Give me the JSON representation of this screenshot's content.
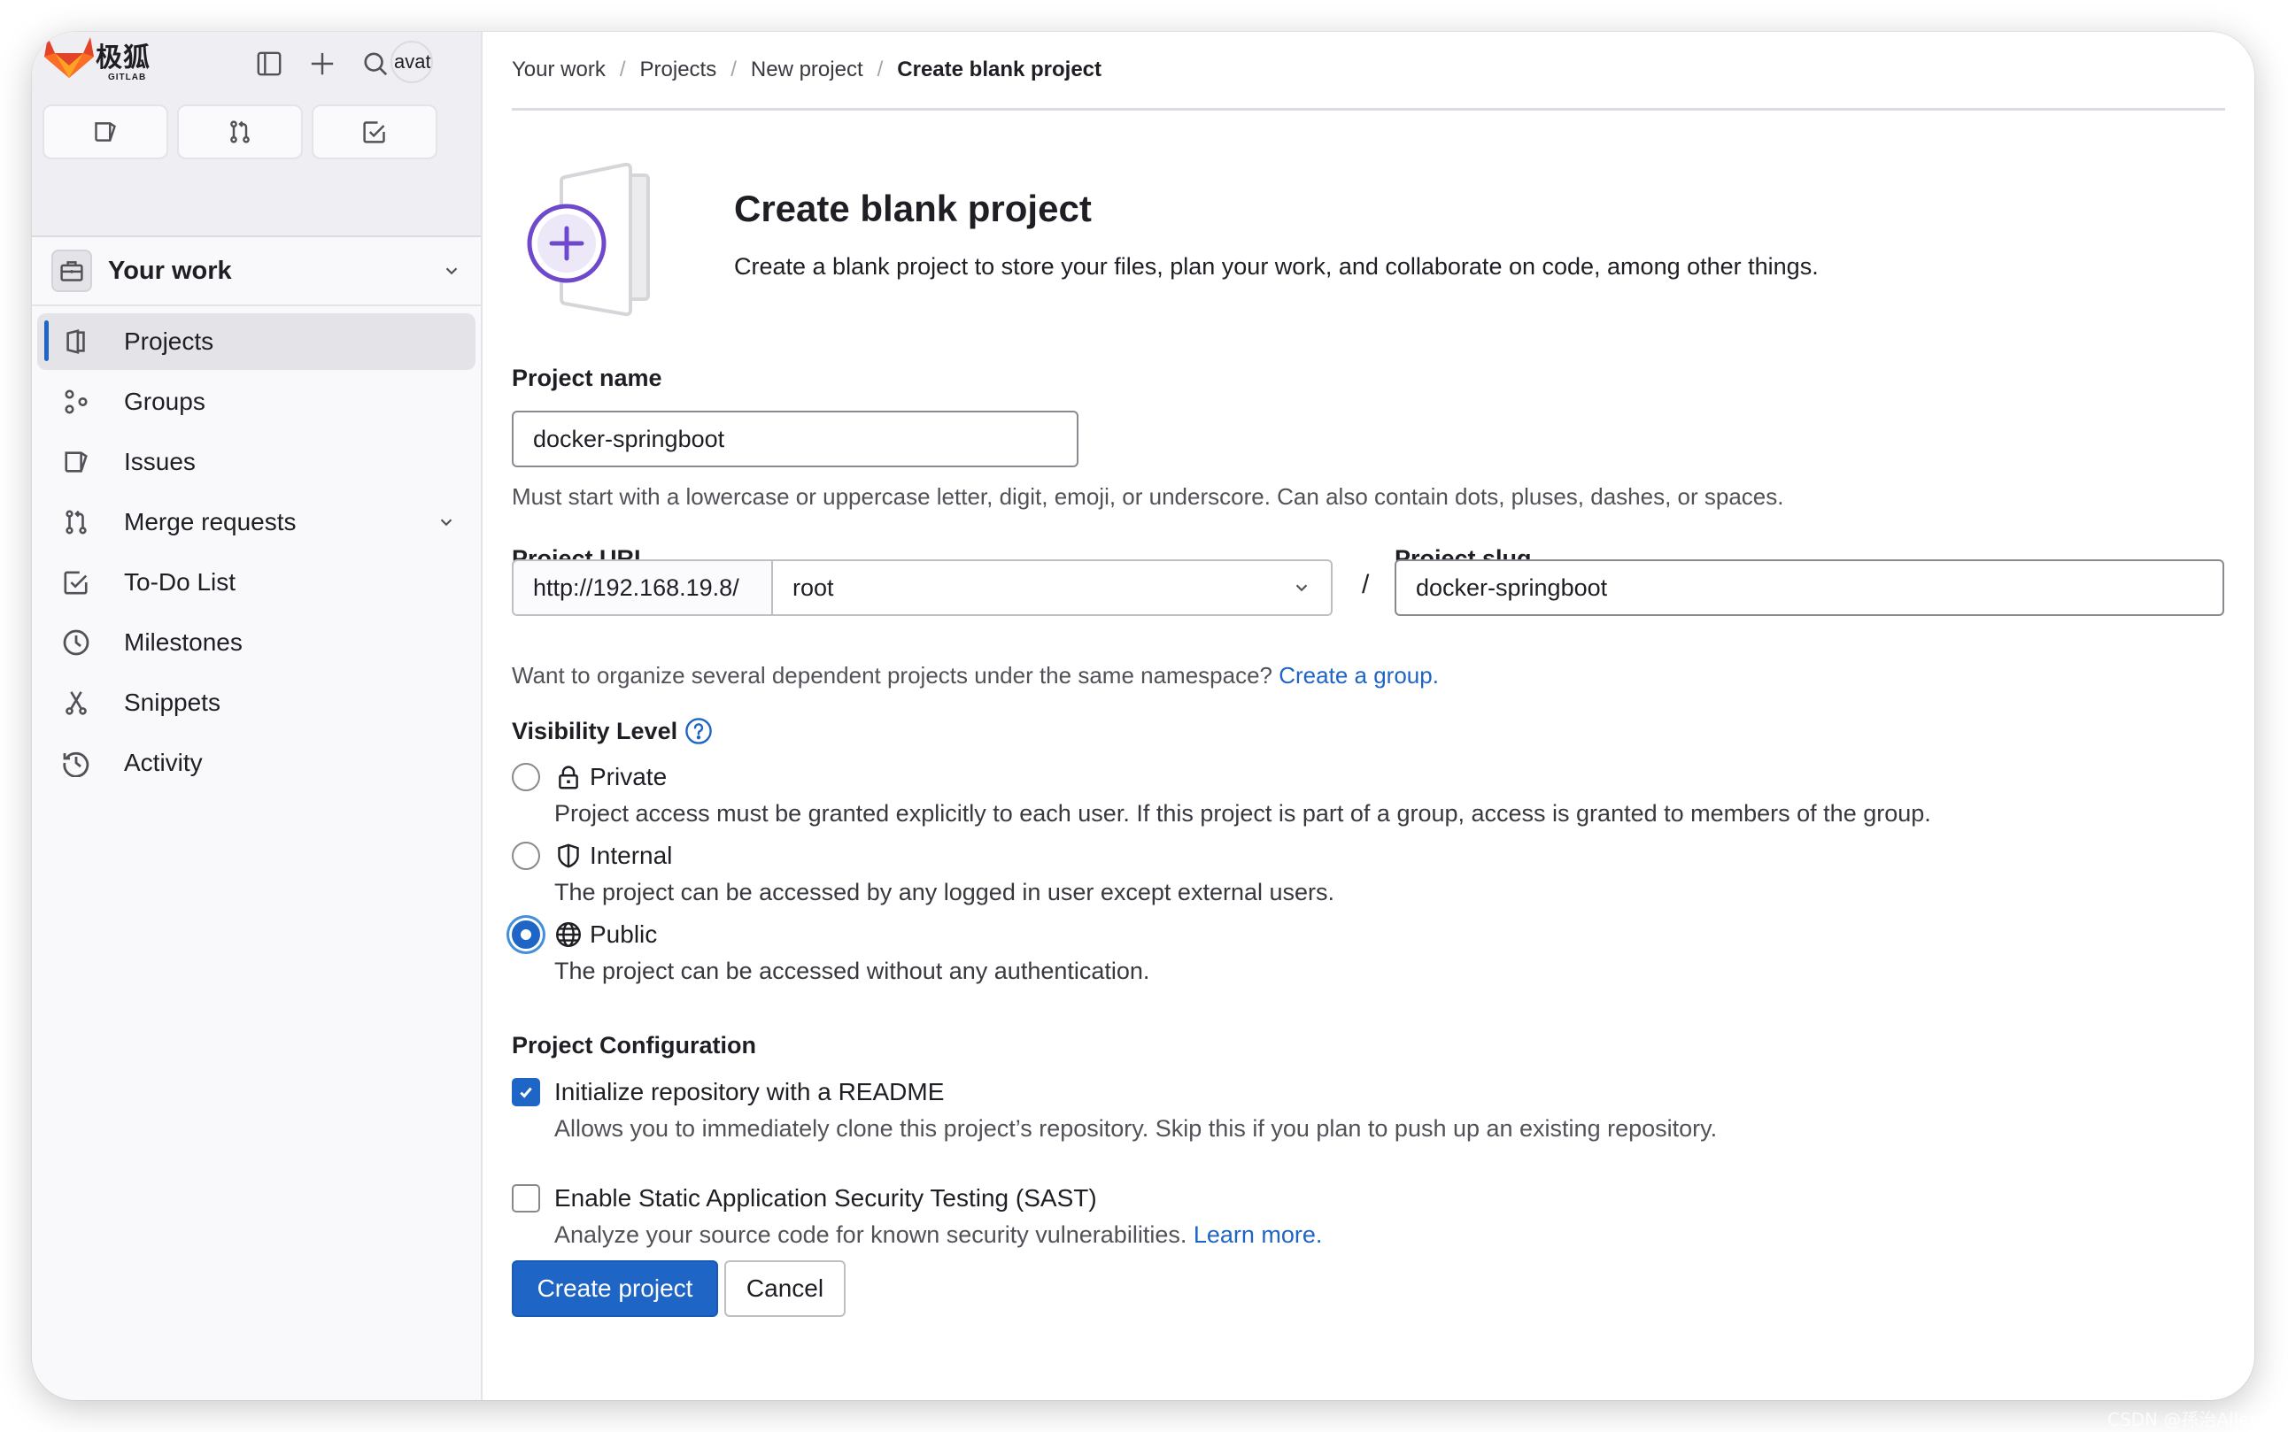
{
  "app": {
    "logo_cn": "极狐",
    "logo_en": "GITLAB",
    "avatar_text": "avatar"
  },
  "sidebar": {
    "top_icons": [
      "sidebar-toggle-icon",
      "plus-icon",
      "search-icon"
    ],
    "quick_buttons": [
      "issues-icon",
      "merge-request-icon",
      "todo-icon"
    ],
    "context": {
      "label": "Your work",
      "icon": "briefcase-icon"
    },
    "items": [
      {
        "label": "Projects",
        "icon": "project-icon",
        "active": true
      },
      {
        "label": "Groups",
        "icon": "group-icon"
      },
      {
        "label": "Issues",
        "icon": "issues-icon"
      },
      {
        "label": "Merge requests",
        "icon": "merge-request-icon",
        "expandable": true
      },
      {
        "label": "To-Do List",
        "icon": "todo-icon"
      },
      {
        "label": "Milestones",
        "icon": "clock-icon"
      },
      {
        "label": "Snippets",
        "icon": "scissors-icon"
      },
      {
        "label": "Activity",
        "icon": "history-icon"
      }
    ]
  },
  "breadcrumb": [
    "Your work",
    "Projects",
    "New project",
    "Create blank project"
  ],
  "hero": {
    "title": "Create blank project",
    "description": "Create a blank project to store your files, plan your work, and collaborate on code, among other things."
  },
  "form": {
    "project_name": {
      "label": "Project name",
      "value": "docker-springboot",
      "help": "Must start with a lowercase or uppercase letter, digit, emoji, or underscore. Can also contain dots, pluses, dashes, or spaces."
    },
    "project_url": {
      "label": "Project URL",
      "prefix": "http://192.168.19.8/",
      "namespace": "root",
      "separator": "/",
      "help": "Want to organize several dependent projects under the same namespace?",
      "help_link": "Create a group."
    },
    "project_slug": {
      "label": "Project slug",
      "value": "docker-springboot"
    },
    "visibility": {
      "label": "Visibility Level",
      "selected": "Public",
      "options": [
        {
          "label": "Private",
          "icon": "lock-icon",
          "description": "Project access must be granted explicitly to each user. If this project is part of a group, access is granted to members of the group."
        },
        {
          "label": "Internal",
          "icon": "shield-icon",
          "description": "The project can be accessed by any logged in user except external users."
        },
        {
          "label": "Public",
          "icon": "globe-icon",
          "description": "The project can be accessed without any authentication."
        }
      ]
    },
    "configuration": {
      "label": "Project Configuration",
      "options": [
        {
          "label": "Initialize repository with a README",
          "checked": true,
          "description": "Allows you to immediately clone this project’s repository. Skip this if you plan to push up an existing repository."
        },
        {
          "label": "Enable Static Application Security Testing (SAST)",
          "checked": false,
          "description": "Analyze your source code for known security vulnerabilities.",
          "link": "Learn more."
        }
      ]
    },
    "buttons": {
      "create": "Create project",
      "cancel": "Cancel"
    }
  },
  "colors": {
    "primary": "#1f65c5",
    "illustration_accent": "#6e49cb"
  },
  "watermark": "CSDN @孫治AllenSu"
}
